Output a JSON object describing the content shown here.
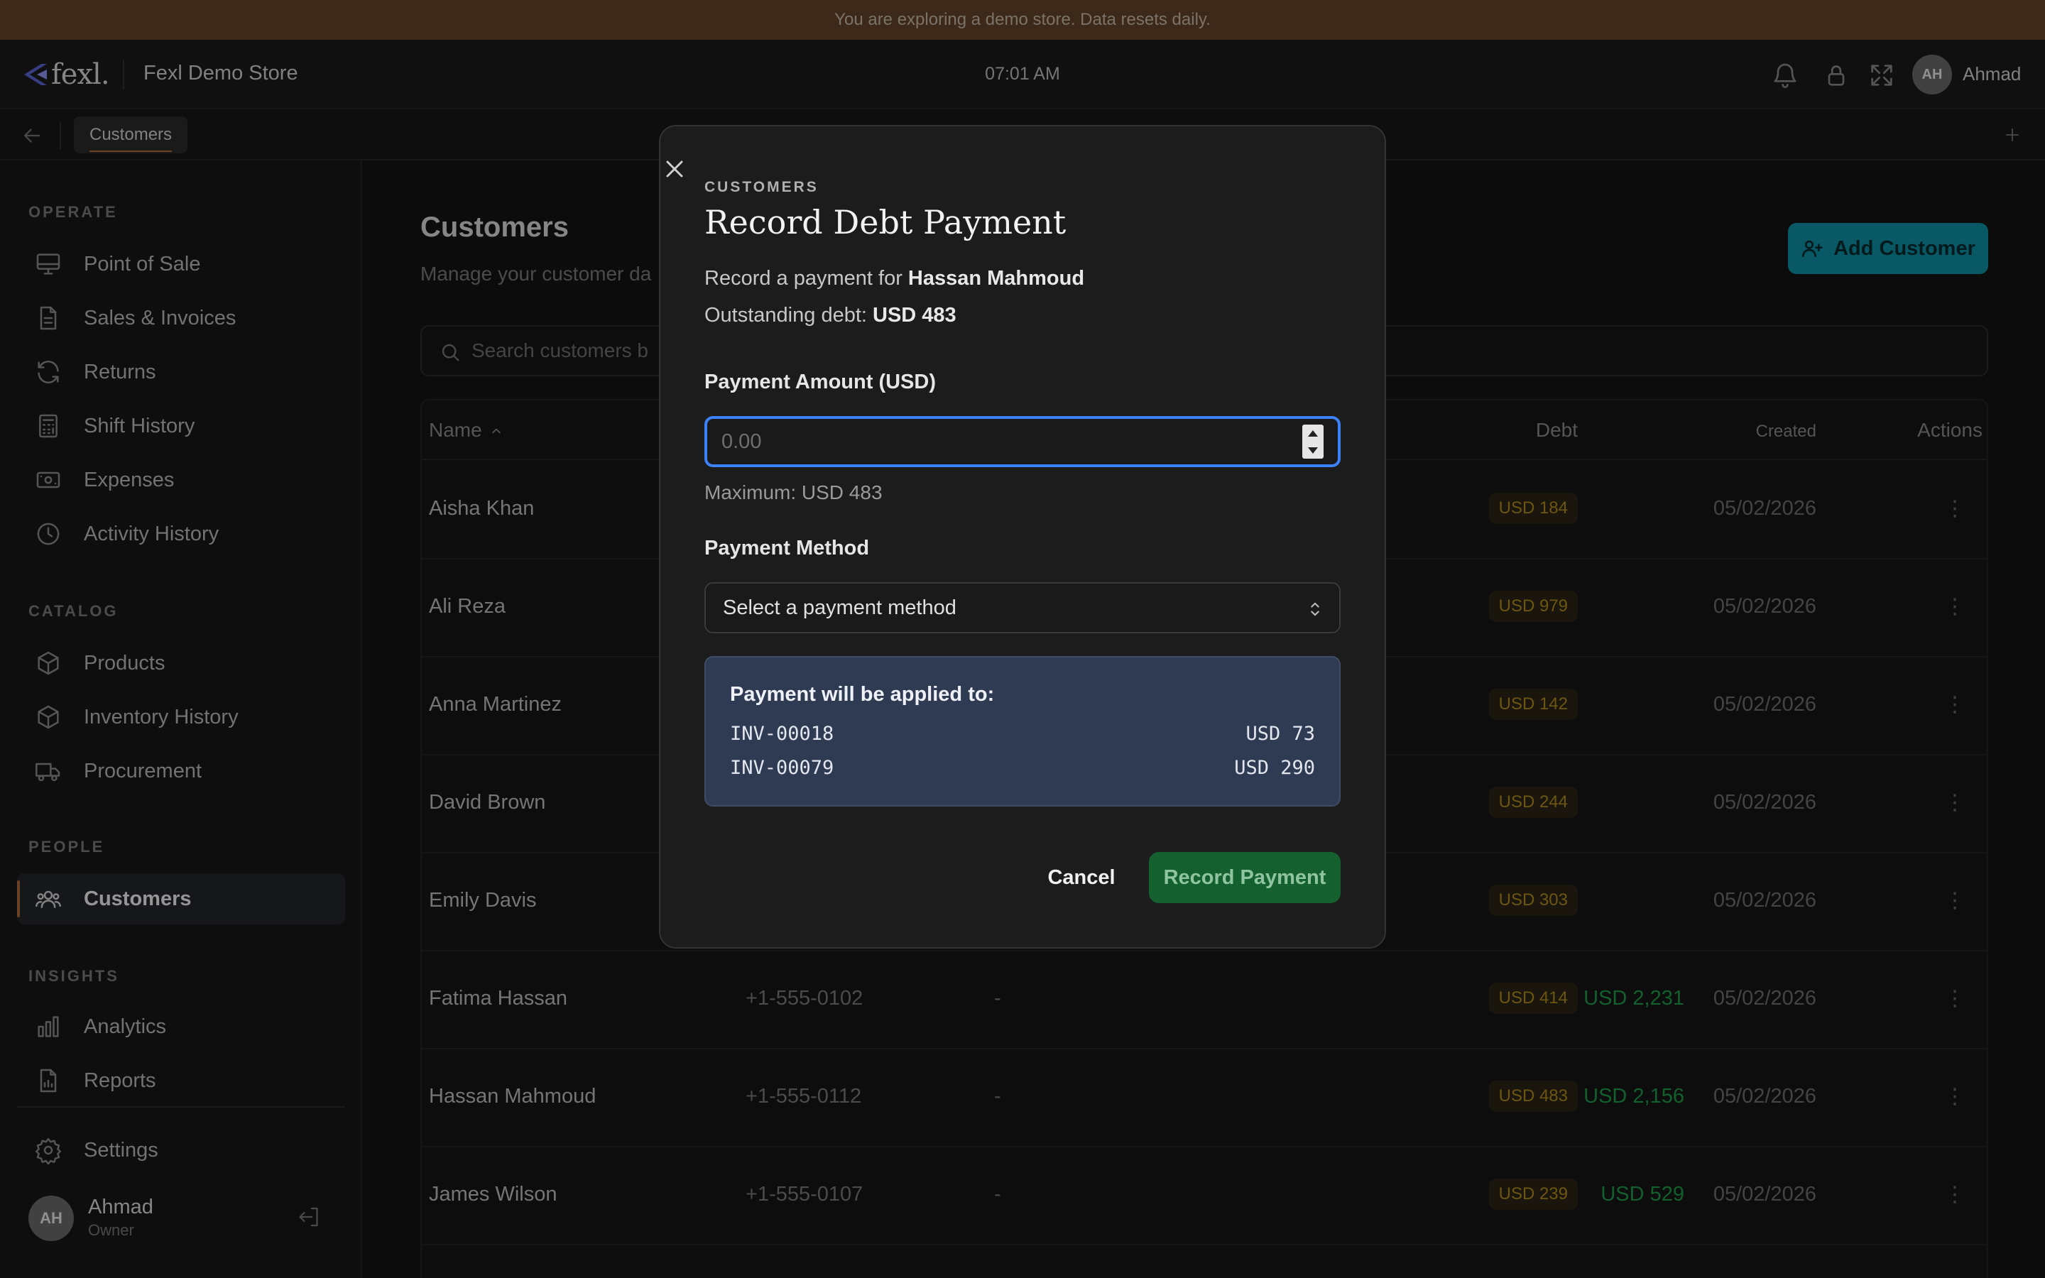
{
  "banner": {
    "text": "You are exploring a demo store. Data resets daily."
  },
  "header": {
    "logo_text": "fexl.",
    "store_name": "Fexl Demo Store",
    "time": "07:01 AM",
    "user_initials": "AH",
    "user_name": "Ahmad",
    "icons": [
      "bell-icon",
      "lock-icon",
      "fullscreen-icon"
    ]
  },
  "tabs": {
    "active": "Customers"
  },
  "sidebar": {
    "sections": [
      {
        "label": "OPERATE",
        "items": [
          {
            "label": "Point of Sale",
            "icon": "monitor-icon"
          },
          {
            "label": "Sales & Invoices",
            "icon": "document-icon"
          },
          {
            "label": "Returns",
            "icon": "refresh-icon"
          },
          {
            "label": "Shift History",
            "icon": "calculator-icon"
          },
          {
            "label": "Expenses",
            "icon": "cash-icon"
          },
          {
            "label": "Activity History",
            "icon": "clock-icon"
          }
        ]
      },
      {
        "label": "CATALOG",
        "items": [
          {
            "label": "Products",
            "icon": "box-icon"
          },
          {
            "label": "Inventory History",
            "icon": "box-icon"
          },
          {
            "label": "Procurement",
            "icon": "truck-icon"
          }
        ]
      },
      {
        "label": "PEOPLE",
        "items": [
          {
            "label": "Customers",
            "icon": "users-icon",
            "active": true
          }
        ]
      },
      {
        "label": "INSIGHTS",
        "items": [
          {
            "label": "Analytics",
            "icon": "bar-chart-icon"
          },
          {
            "label": "Reports",
            "icon": "report-icon"
          }
        ]
      }
    ],
    "settings_label": "Settings",
    "user": {
      "initials": "AH",
      "name": "Ahmad",
      "role": "Owner"
    }
  },
  "main": {
    "title": "Customers",
    "subtitle": "Manage your customer da",
    "add_button": "Add Customer",
    "search_placeholder": "Search customers b",
    "columns": {
      "name": "Name",
      "debt": "Debt",
      "created": "Created",
      "actions": "Actions"
    },
    "rows": [
      {
        "name": "Aisha Khan",
        "phone": "",
        "dash": "",
        "spent": "",
        "debt": "USD 184",
        "created": "05/02/2026"
      },
      {
        "name": "Ali Reza",
        "phone": "",
        "dash": "",
        "spent": "",
        "debt": "USD 979",
        "created": "05/02/2026"
      },
      {
        "name": "Anna Martinez",
        "phone": "",
        "dash": "",
        "spent": "",
        "debt": "USD 142",
        "created": "05/02/2026"
      },
      {
        "name": "David Brown",
        "phone": "",
        "dash": "",
        "spent": "",
        "debt": "USD 244",
        "created": "05/02/2026"
      },
      {
        "name": "Emily Davis",
        "phone": "",
        "dash": "",
        "spent": "",
        "debt": "USD 303",
        "created": "05/02/2026"
      },
      {
        "name": "Fatima Hassan",
        "phone": "+1-555-0102",
        "dash": "-",
        "spent": "USD 2,231",
        "debt": "USD 414",
        "created": "05/02/2026"
      },
      {
        "name": "Hassan Mahmoud",
        "phone": "+1-555-0112",
        "dash": "-",
        "spent": "USD 2,156",
        "debt": "USD 483",
        "created": "05/02/2026"
      },
      {
        "name": "James Wilson",
        "phone": "+1-555-0107",
        "dash": "-",
        "spent": "USD 529",
        "debt": "USD 239",
        "created": "05/02/2026"
      }
    ]
  },
  "modal": {
    "eyebrow": "CUSTOMERS",
    "title": "Record Debt Payment",
    "record_prefix": "Record a payment for ",
    "customer_name": "Hassan Mahmoud",
    "debt_prefix": "Outstanding debt: ",
    "outstanding_debt": "USD 483",
    "amount_label": "Payment Amount (USD)",
    "amount_placeholder": "0.00",
    "amount_value": "",
    "max_text": "Maximum: USD 483",
    "method_label": "Payment Method",
    "method_placeholder": "Select a payment method",
    "applied_title": "Payment will be applied to:",
    "applied": [
      {
        "invoice": "INV-00018",
        "amount": "USD 73"
      },
      {
        "invoice": "INV-00079",
        "amount": "USD 290"
      }
    ],
    "cancel_label": "Cancel",
    "submit_label": "Record Payment"
  }
}
